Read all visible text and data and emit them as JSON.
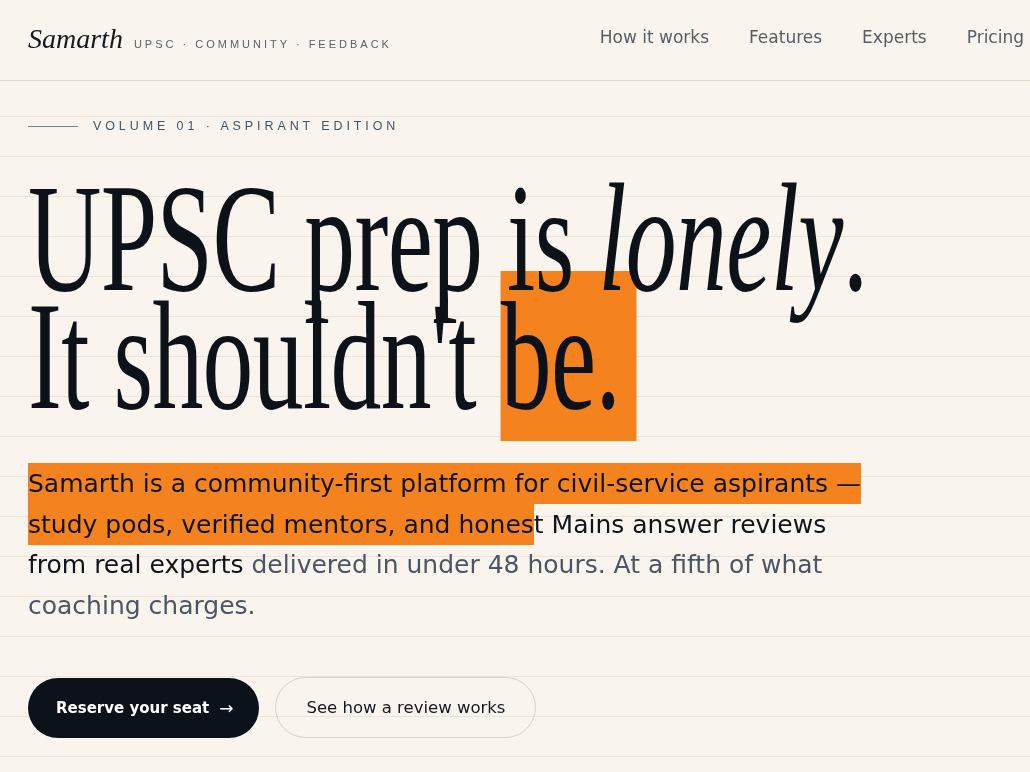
{
  "header": {
    "brand": "Samarth",
    "tagline": "UPSC · COMMUNITY · FEEDBACK",
    "nav": [
      "How it works",
      "Features",
      "Experts",
      "Pricing"
    ]
  },
  "hero": {
    "eyebrow": "VOLUME 01 · ASPIRANT EDITION",
    "headline": {
      "lines": [
        {
          "segments": [
            {
              "text": "UPSC prep is *lonely*.",
              "selected": false
            }
          ]
        },
        {
          "segments": [
            {
              "text": "It shouldn't ",
              "selected": false
            },
            {
              "text": "be.",
              "selected": true
            }
          ]
        }
      ]
    },
    "intro": {
      "segments": [
        {
          "text": "Samarth is a community-first platform for civil-service aspirants — study pods, verified mentors, and hones",
          "selected": true,
          "emphasis": true
        },
        {
          "text": "t Mains answer reviews from real experts",
          "selected": false,
          "emphasis": true
        },
        {
          "text": " delivered in under 48 hours. At a fifth of what coaching charges.",
          "selected": false,
          "emphasis": false
        }
      ]
    },
    "buttons": [
      {
        "kind": "primary",
        "label": "Reserve your seat",
        "icon": "→"
      },
      {
        "kind": "secondary",
        "label": "See how a review works"
      }
    ]
  }
}
